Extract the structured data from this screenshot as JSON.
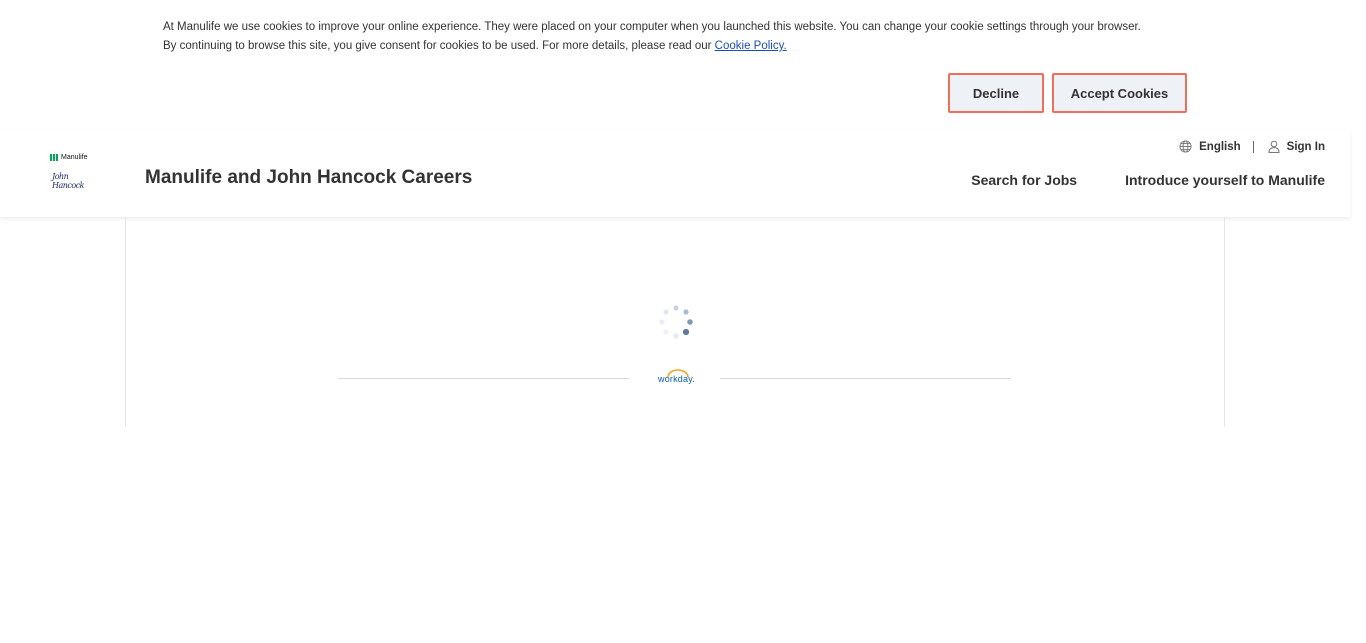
{
  "cookie_banner": {
    "line1": "At Manulife we use cookies to improve your online experience. They were placed on your computer when you launched this website. You can change your cookie settings through your browser.",
    "line2": "By continuing to browse this site, you give consent for cookies to be used. For more details, please read our ",
    "link_text": "Cookie Policy.",
    "decline_label": "Decline",
    "accept_label": "Accept Cookies",
    "button_border_color": "#f06f5b"
  },
  "header": {
    "logo_manulife_text": "Manulife",
    "logo_jh_text": "John Hancock",
    "title": "Manulife and John Hancock Careers",
    "language_label": "English",
    "sign_in_label": "Sign In",
    "icons": [
      "globe-icon",
      "user-icon"
    ],
    "nav": [
      {
        "label": "Search for Jobs"
      },
      {
        "label": "Introduce yourself to Manulife"
      }
    ]
  },
  "content": {
    "loading": true,
    "workday_label": "workday."
  },
  "colors": {
    "accent": "#00a758",
    "link": "#1a4fbf",
    "workday": "#0b5cab"
  }
}
